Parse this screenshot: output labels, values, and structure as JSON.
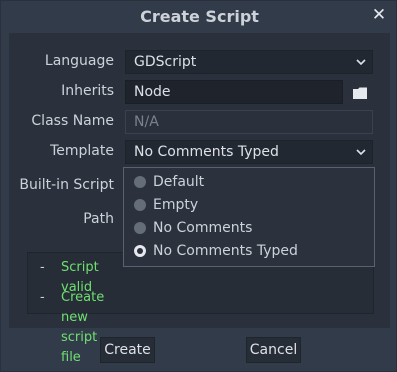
{
  "window": {
    "title": "Create Script",
    "close_glyph": "✕"
  },
  "form": {
    "language": {
      "label": "Language",
      "value": "GDScript"
    },
    "inherits": {
      "label": "Inherits",
      "value": "Node"
    },
    "class_name": {
      "label": "Class Name",
      "placeholder": "N/A"
    },
    "template": {
      "label": "Template",
      "value": "No Comments Typed"
    },
    "builtin": {
      "label": "Built-in Script"
    },
    "path": {
      "label": "Path"
    }
  },
  "template_options": [
    {
      "label": "Default",
      "selected": false
    },
    {
      "label": "Empty",
      "selected": false
    },
    {
      "label": "No Comments",
      "selected": false
    },
    {
      "label": "No Comments Typed",
      "selected": true
    }
  ],
  "status": [
    {
      "dash": "-",
      "text": "Script valid"
    },
    {
      "dash": "-",
      "text": "Create new script file"
    }
  ],
  "buttons": {
    "create": "Create",
    "cancel": "Cancel"
  },
  "colors": {
    "accent_green": "#6fe070",
    "panel": "#2a313c",
    "frame": "#323b49"
  },
  "icons": {
    "folder": "folder-icon",
    "chevron": "chevron-down-icon",
    "close": "close-icon"
  }
}
